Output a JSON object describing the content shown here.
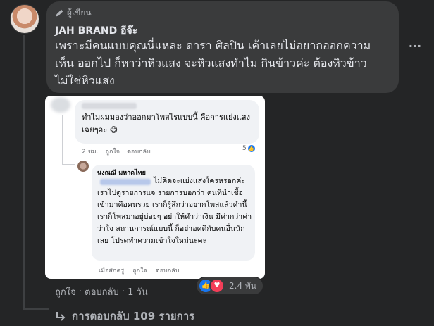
{
  "comment": {
    "author_badge": "ผู้เขียน",
    "author_name": "JAH BRAND อีจ๊ะ",
    "text": "เพราะมีคนแบบคุณนี่แหละ ดารา ศิลปิน เค้าเลยไม่อยากออกความเห็น ออกไป ก็หาว่าหิวแสง จะหิวแสงทำไม กินข้าวค่ะ ต้องหิวข้าว ไม่ใช่หิวแสง",
    "more_icon": "more-dots-icon"
  },
  "attachment": {
    "comment1": {
      "text": "ทำไมผมมองว่าออกมาโพสไรแบบนี้ คือการแย่งแสงเฉยๆอะ 😅",
      "time": "2 ชม.",
      "like": "ถูกใจ",
      "reply": "ตอบกลับ",
      "reaction_count": "5"
    },
    "comment2": {
      "name": "นงณณี มหาดไทย",
      "text": "ไม่คิดจะแย่งแสงใครหรอกค่ะ เราไปดูรายการแจ รายการบอกว่า คนที่นำเชื้อเข้ามาคือคนรวย เราก็รู้สึกว่าอยากโพสแล้วคำนี้เราก็โพสมาอยู่บ่อยๆ อย่าให้คำว่าเงิน มีค่ากว่าค่าว่าใจ สถานการณ์แบบนี้ ก็อย่าอคติกับคนอื่นนักเลย โปรดทำความเข้าใจใหม่นะคะ",
      "time": "เมื่อสักครู่",
      "like": "ถูกใจ",
      "reply": "ตอบกลับ"
    }
  },
  "actions": {
    "like": "ถูกใจ",
    "sep1": " · ",
    "reply": "ตอบกลับ",
    "sep2": " · ",
    "time": "1 วัน"
  },
  "reactions": {
    "count": "2.4 พัน"
  },
  "replies_link": "การตอบกลับ 109 รายการ",
  "colors": {
    "background": "#242526",
    "bubble": "#3a3b3c",
    "text": "#e4e6eb",
    "muted": "#b0b3b8",
    "like_blue": "#1877f2",
    "love_red": "#f33e58"
  }
}
